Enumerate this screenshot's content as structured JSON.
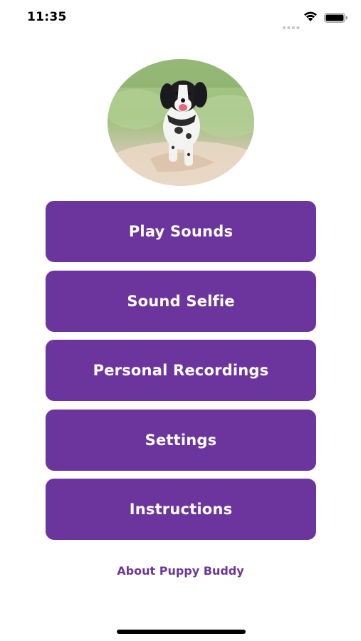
{
  "status_bar": {
    "time": "11:35"
  },
  "avatar": {
    "icon": "puppy-photo"
  },
  "menu": {
    "items": [
      {
        "label": "Play Sounds"
      },
      {
        "label": "Sound Selfie"
      },
      {
        "label": "Personal Recordings"
      },
      {
        "label": "Settings"
      },
      {
        "label": "Instructions"
      }
    ]
  },
  "footer": {
    "about_label": "About Puppy Buddy"
  },
  "colors": {
    "accent": "#6c359d",
    "button_text": "#ffffff",
    "background": "#ffffff"
  }
}
